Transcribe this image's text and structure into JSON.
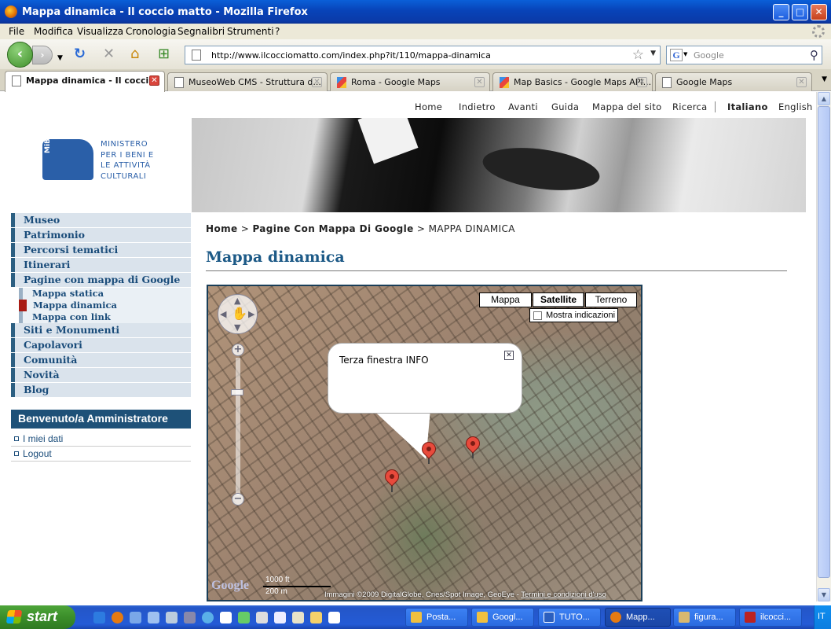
{
  "window": {
    "title": "Mappa dinamica - Il coccio matto - Mozilla Firefox"
  },
  "menu": [
    "File",
    "Modifica",
    "Visualizza",
    "Cronologia",
    "Segnalibri",
    "Strumenti",
    "?"
  ],
  "address": {
    "url": "http://www.ilcocciomatto.com/index.php?it/110/mappa-dinamica"
  },
  "search": {
    "placeholder": "Google"
  },
  "tabs": [
    {
      "label": "Mappa dinamica - Il cocci...",
      "icon": "page-icon"
    },
    {
      "label": "MuseoWeb CMS - Struttura d...",
      "icon": "page-icon"
    },
    {
      "label": "Roma - Google Maps",
      "icon": "google-maps-icon"
    },
    {
      "label": "Map Basics - Google Maps API...",
      "icon": "google-maps-icon"
    },
    {
      "label": "Google Maps",
      "icon": "page-icon"
    }
  ],
  "site": {
    "topnav": [
      "Home",
      "Indietro",
      "Avanti",
      "Guida",
      "Mappa del sito",
      "Ricerca",
      "Italiano",
      "English"
    ],
    "logo": {
      "badge": "MiBAC",
      "lines": [
        "MINISTERO",
        "PER I BENI E",
        "LE ATTIVITÀ",
        "CULTURALI"
      ]
    },
    "sidenav": [
      "Museo",
      "Patrimonio",
      "Percorsi tematici",
      "Itinerari",
      "Pagine con mappa di Google",
      "Siti e Monumenti",
      "Capolavori",
      "Comunità",
      "Novità",
      "Blog"
    ],
    "subnav": [
      "Mappa statica",
      "Mappa dinamica",
      "Mappa con link"
    ],
    "admin": {
      "title": "Benvenuto/a Amministratore",
      "links": [
        "I miei dati",
        "Logout"
      ]
    },
    "breadcrumb": {
      "home": "Home",
      "sep": ">",
      "parent": "Pagine Con Mappa Di Google",
      "current": "MAPPA DINAMICA"
    },
    "page_title": "Mappa dinamica"
  },
  "map": {
    "types": [
      "Mappa",
      "Satellite",
      "Terreno"
    ],
    "selected_type": "Satellite",
    "show_labels": "Mostra indicazioni",
    "infowindow": "Terza finestra INFO",
    "scale": {
      "ft": "1000 ft",
      "m": "200 m"
    },
    "google": "Google",
    "copyright": "Immagini ©2009 DigitalGlobe, Cnes/Spot Image, GeoEye -",
    "terms": "Termini e condizioni d'uso"
  },
  "taskbar": {
    "start": "start",
    "tasks": [
      "Posta...",
      "Googl...",
      "TUTO...",
      "Mapp...",
      "figura...",
      "ilcocci..."
    ],
    "active_task": "Mapp...",
    "lang": "IT"
  },
  "colors": {
    "nav_accent": "#2c5f82",
    "nav_text": "#1a4c7a",
    "active_marker": "#a81b14",
    "admin_bar": "#1e5178",
    "pin": "#e84a3c"
  }
}
